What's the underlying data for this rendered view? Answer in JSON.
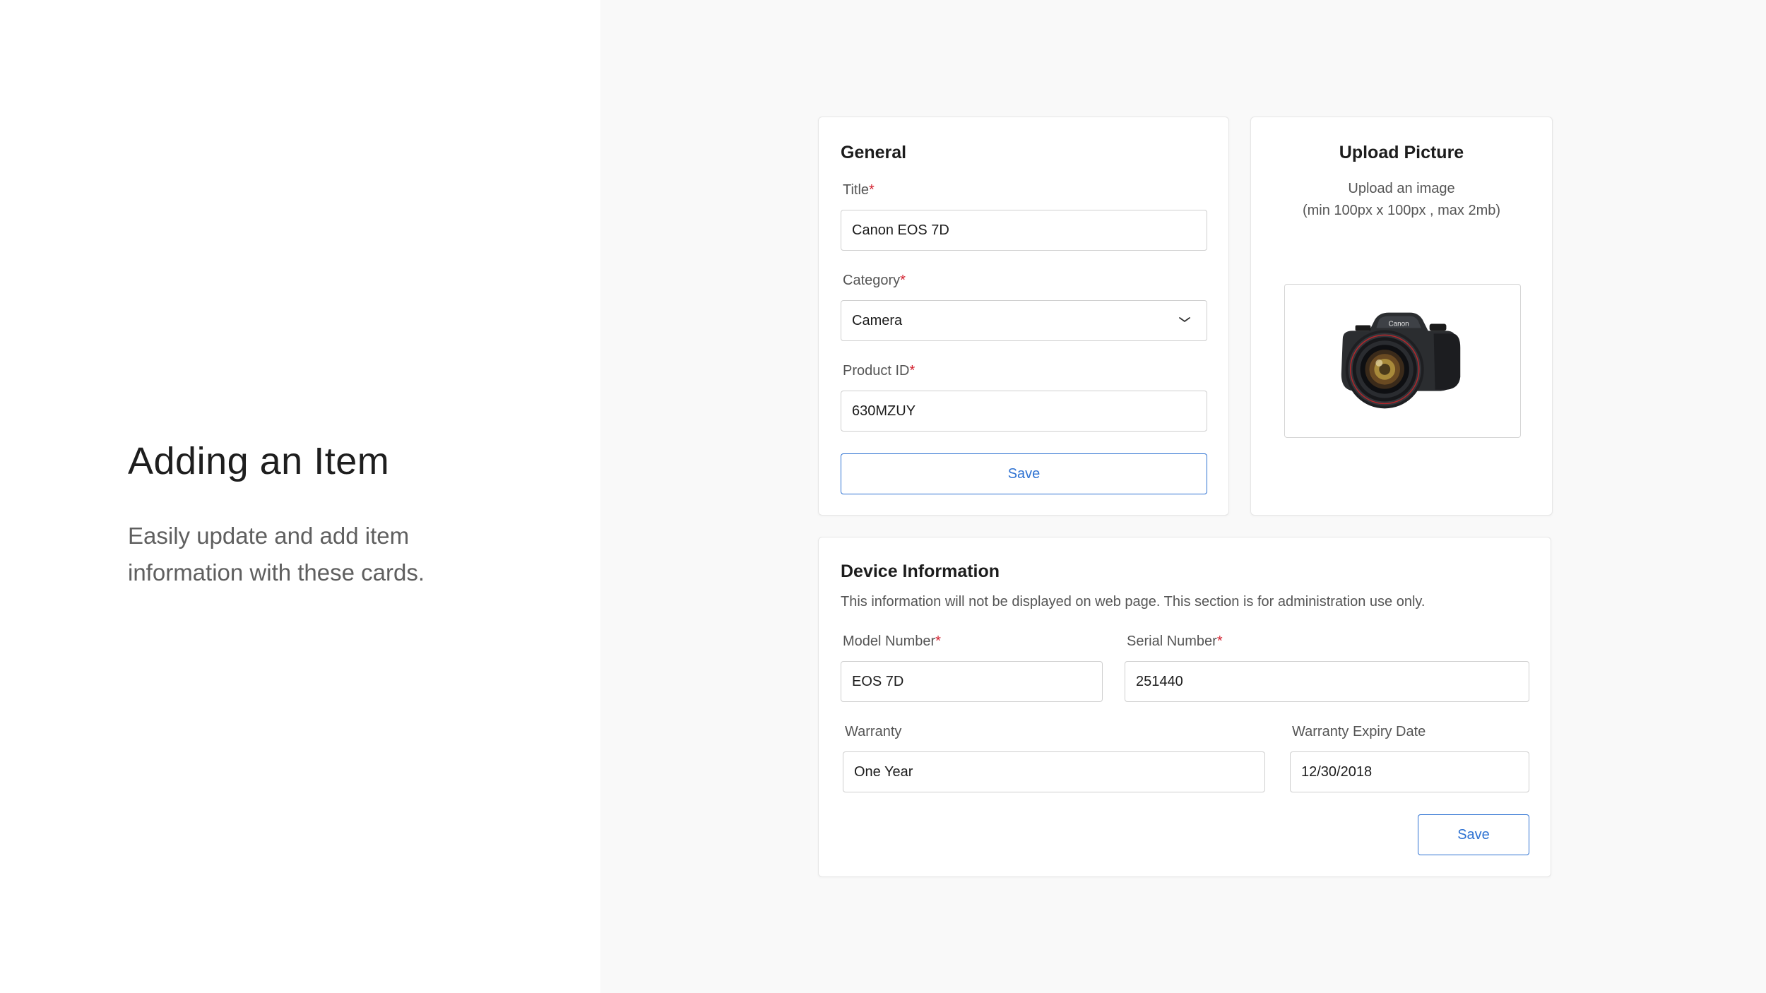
{
  "hero": {
    "title": "Adding an Item",
    "subtitle": "Easily update and add item information with these cards."
  },
  "general": {
    "title": "General",
    "title_label": "Title",
    "title_value": "Canon EOS 7D",
    "category_label": "Category",
    "category_value": "Camera",
    "product_id_label": "Product ID",
    "product_id_value": "630MZUY",
    "save_label": "Save",
    "required_mark": "*"
  },
  "upload": {
    "title": "Upload Picture",
    "line1": "Upload an image",
    "line2": "(min 100px x 100px , max 2mb)",
    "camera_brand": "Canon"
  },
  "device": {
    "title": "Device Information",
    "description": "This information will not be displayed on web page. This section is for administration use only.",
    "model_label": "Model Number",
    "model_value": "EOS 7D",
    "serial_label": "Serial Number",
    "serial_value": "251440",
    "warranty_label": "Warranty",
    "warranty_value": "One Year",
    "expiry_label": "Warranty Expiry Date",
    "expiry_value": "12/30/2018",
    "save_label": "Save",
    "required_mark": "*"
  },
  "colors": {
    "accent": "#2e72d2",
    "required": "#d21f2d",
    "panel_bg": "#f9f9f9"
  },
  "icons": {
    "select_chevron": "chevron-down-icon"
  }
}
